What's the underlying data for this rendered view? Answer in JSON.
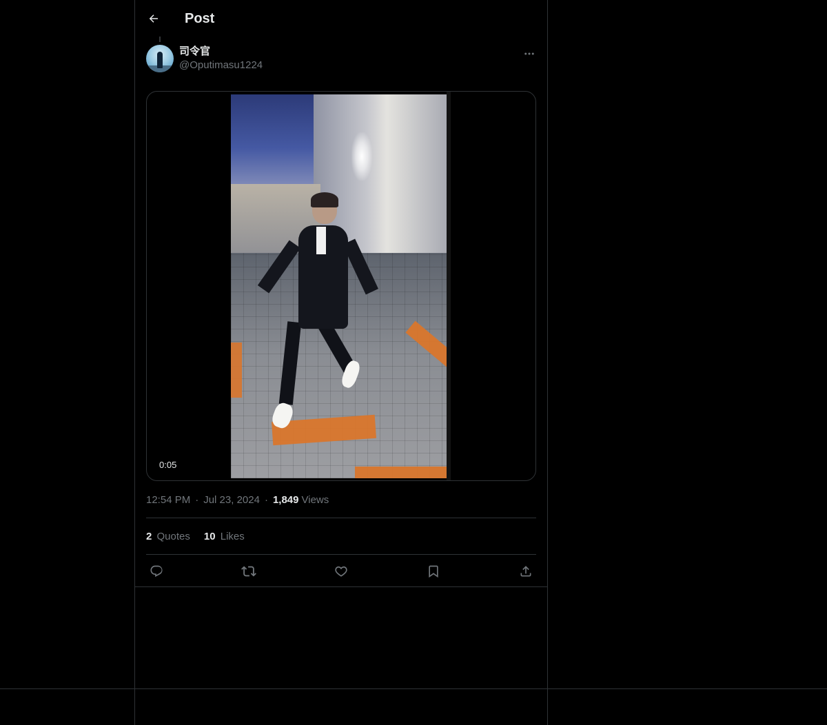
{
  "header": {
    "back_icon": "arrow-left-icon",
    "title": "Post"
  },
  "post": {
    "author": {
      "display_name": "司令官",
      "handle": "@Oputimasu1224",
      "avatar_icon": "avatar-image"
    },
    "more_icon": "more-horizontal-icon",
    "media": {
      "type": "video",
      "duration": "0:05"
    },
    "meta": {
      "time": "12:54 PM",
      "separator": "·",
      "date": "Jul 23, 2024",
      "views_count": "1,849",
      "views_label": "Views"
    },
    "stats": {
      "quotes_count": "2",
      "quotes_label": "Quotes",
      "likes_count": "10",
      "likes_label": "Likes"
    },
    "actions": [
      {
        "name": "reply",
        "icon": "reply-icon"
      },
      {
        "name": "repost",
        "icon": "repost-icon"
      },
      {
        "name": "like",
        "icon": "heart-icon"
      },
      {
        "name": "bookmark",
        "icon": "bookmark-icon"
      },
      {
        "name": "share",
        "icon": "share-icon"
      }
    ]
  },
  "colors": {
    "background": "#000000",
    "border": "#2f3336",
    "text_primary": "#e7e9ea",
    "text_secondary": "#71767b"
  }
}
